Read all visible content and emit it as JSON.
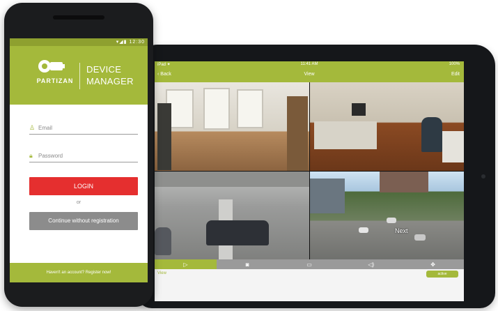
{
  "phone": {
    "status_time": "12:30",
    "status_icons": "▾◢▮",
    "brand": "PARTIZAN",
    "app_title_line1": "DEVICE",
    "app_title_line2": "MANAGER",
    "email_placeholder": "Email",
    "password_placeholder": "Password",
    "login_label": "LOGIN",
    "or_text": "or",
    "guest_label": "Continue without registration",
    "footer_text": "Haven't an account? Register now!"
  },
  "tablet": {
    "status_left": "iPad ✦",
    "status_time": "11:41 AM",
    "status_battery": "100%",
    "back_label": "‹ Back",
    "title": "View",
    "edit_label": "Edit",
    "camera_overlay": "Next",
    "footer_left": "View",
    "footer_button": "active",
    "tabs": [
      {
        "icon": "▷",
        "name": "play"
      },
      {
        "icon": "◙",
        "name": "camera"
      },
      {
        "icon": "▭",
        "name": "record"
      },
      {
        "icon": "◁)",
        "name": "audio"
      },
      {
        "icon": "✥",
        "name": "ptz"
      }
    ]
  },
  "colors": {
    "brand_green": "#a4b93b",
    "login_red": "#e52f2f",
    "guest_gray": "#8c8c8c"
  }
}
